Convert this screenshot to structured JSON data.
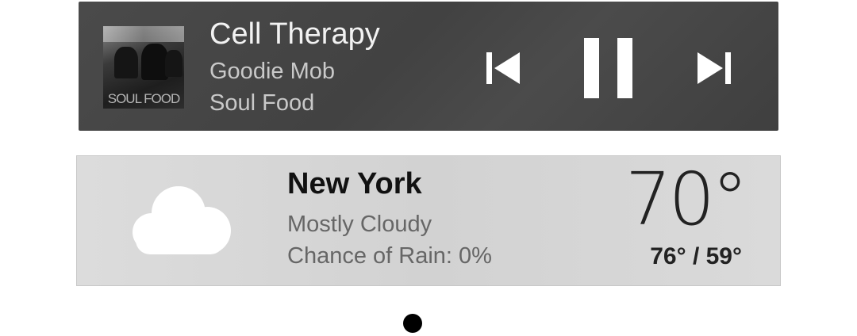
{
  "music": {
    "title": "Cell Therapy",
    "artist": "Goodie Mob",
    "album": "Soul Food",
    "album_art_caption": "SOUL FOOD",
    "controls": {
      "previous_icon": "skip-previous-icon",
      "play_pause_icon": "pause-icon",
      "next_icon": "skip-next-icon"
    },
    "colors": {
      "background": "#454545",
      "title": "#f2f2f2",
      "subtitle": "#c9c9c9",
      "icon": "#ffffff"
    }
  },
  "weather": {
    "city": "New York",
    "condition": "Mostly Cloudy",
    "rain_chance": "Chance of Rain: 0%",
    "temperature": "70°",
    "high_low": "76° / 59°",
    "icon": "cloud-icon",
    "colors": {
      "background": "#d6d6d6",
      "city": "#111111",
      "detail": "#666666",
      "cloud": "#ffffff"
    }
  },
  "pager": {
    "pages": 1,
    "active_page": 1
  }
}
